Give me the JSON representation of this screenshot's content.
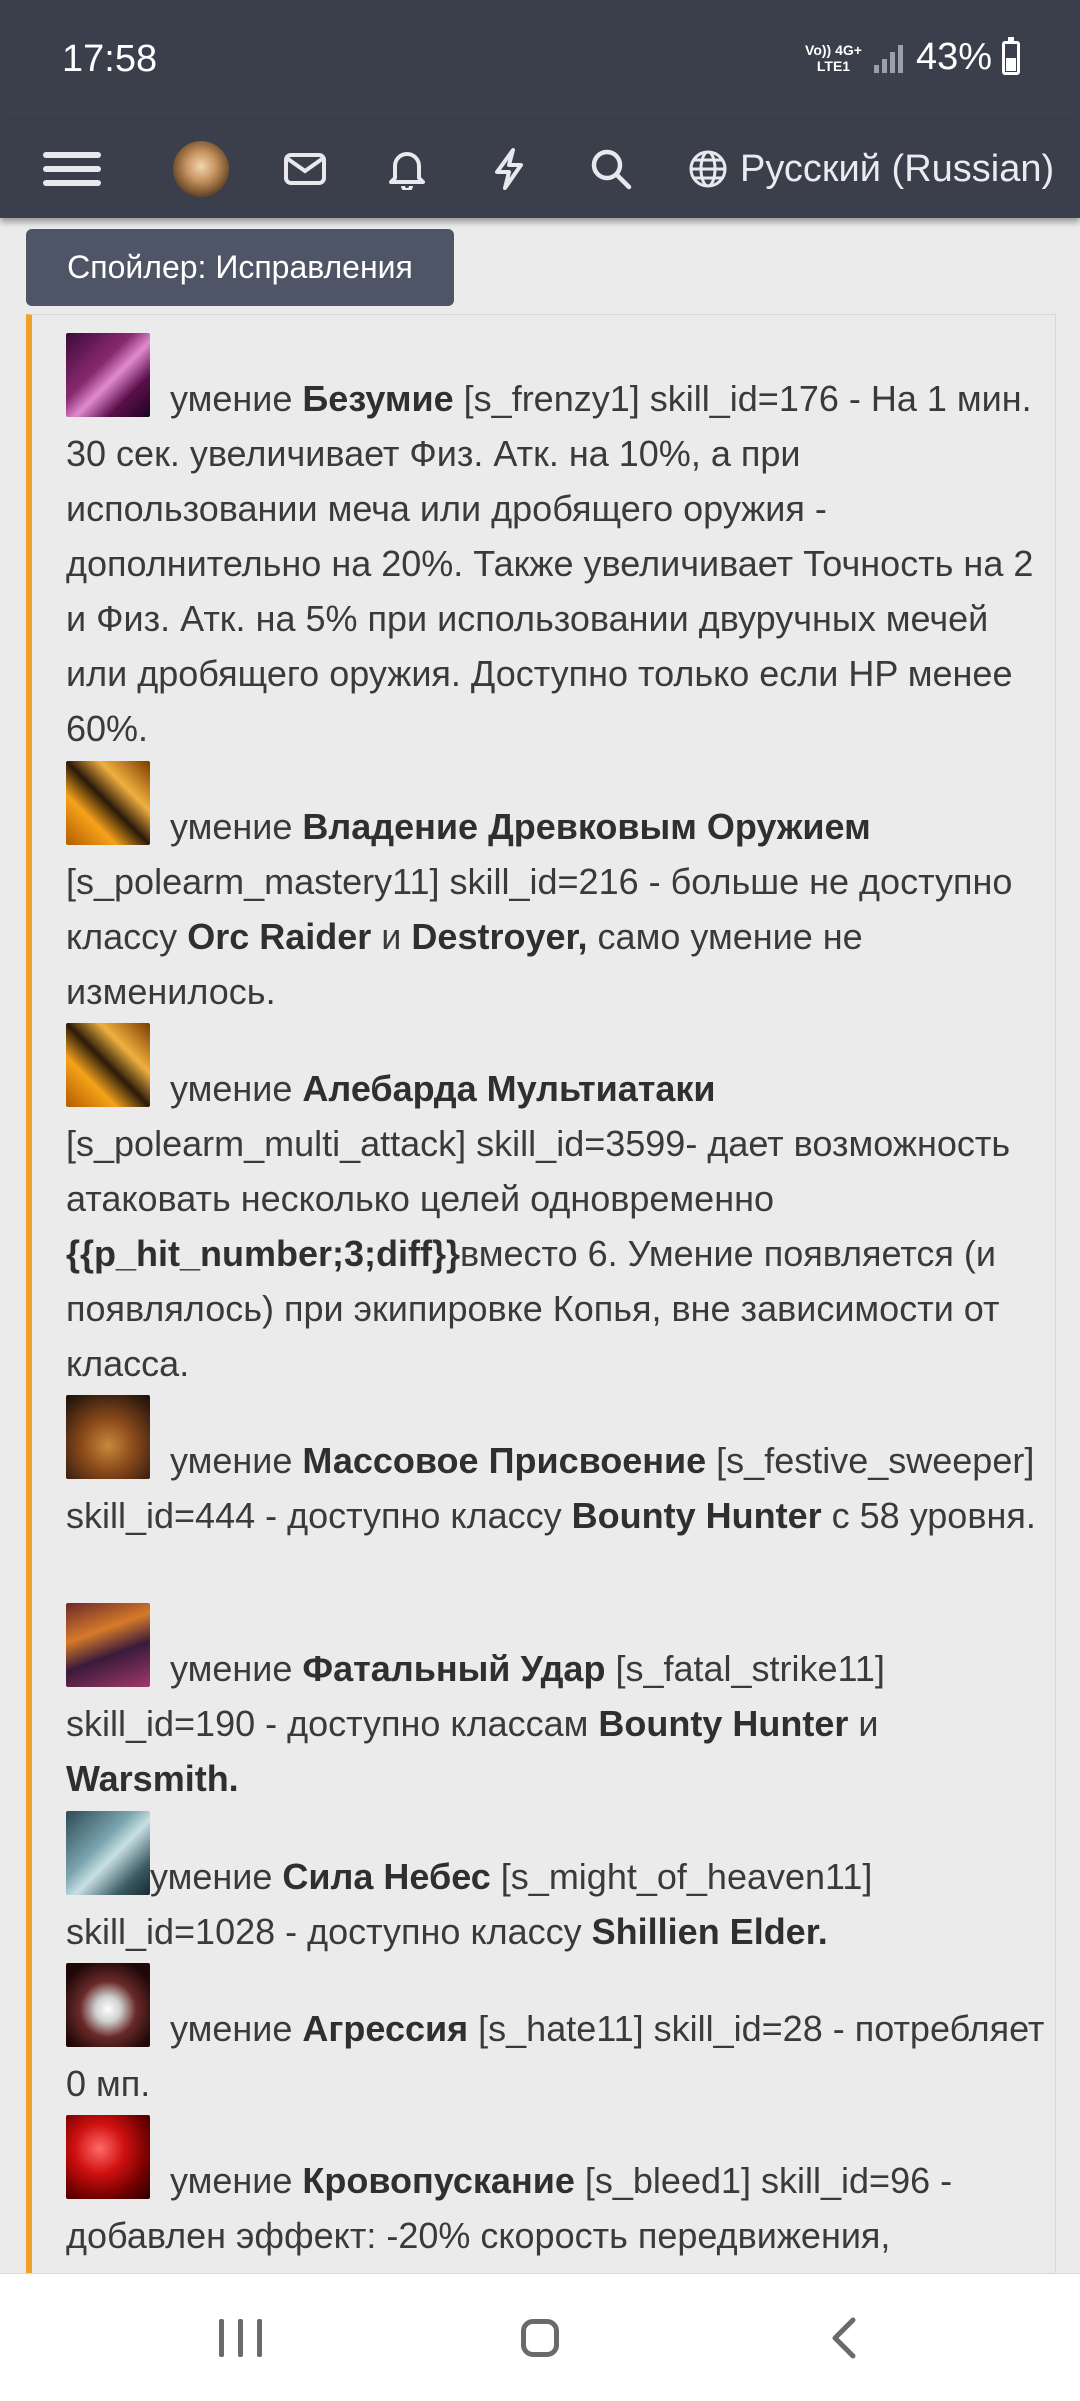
{
  "status_bar": {
    "time": "17:58",
    "network_top": "Vo)) 4G+",
    "network_bottom": "LTE1",
    "battery_percent": "43%",
    "battery_level": 0.43
  },
  "nav": {
    "language": "Русский (Russian)",
    "icons": [
      "menu-icon",
      "avatar",
      "mail-icon",
      "bell-icon",
      "lightning-icon",
      "search-icon",
      "globe-icon"
    ]
  },
  "spoiler": {
    "label": "Спойлер: Исправления"
  },
  "entries": [
    {
      "prefix": "умение",
      "name": "Безумие",
      "text1": "[s_frenzy1] skill_id=176 - На 1 мин. 30 сек. увеличивает Физ. Атк. на 10%, а при использовании меча или дробящего оружия - дополнительно на 20%. Также увеличивает Точность на 2 и Физ. Атк. на 5% при использовании двуручных мечей или дробящего оружия. Доступно только если HP менее 60%."
    },
    {
      "prefix": "умение",
      "name": "Владение Древковым Оружием",
      "text1": "[s_polearm_mastery11] skill_id=216 - больше не доступно классу",
      "bold2": "Orc Raider",
      "text2": "и",
      "bold3": "Destroyer,",
      "text3": "само умение не изменилось."
    },
    {
      "prefix": "умение",
      "name": "Алебарда Мультиатаки",
      "text1": "[s_polearm_multi_attack] skill_id=3599- дает возможность атаковать несколько целей одновременно",
      "bold2": "{{p_hit_number;3;diff}}",
      "text2": "вместо 6. Умение появляется (и появлялось) при экипировке Копья, вне зависимости от класса."
    },
    {
      "prefix": "умение",
      "name": "Массовое Присвоение",
      "text1": "[s_festive_sweeper] skill_id=444 - доступно классу",
      "bold2": "Bounty Hunter",
      "text2": "с 58 уровня."
    },
    {
      "prefix": "умение",
      "name": "Фатальный Удар",
      "text1": "[s_fatal_strike11] skill_id=190 - доступно классам",
      "bold2": "Bounty Hunter",
      "text2": "и",
      "bold3": "Warsmith."
    },
    {
      "prefix": "умение",
      "name": "Сила Небес",
      "text1": "[s_might_of_heaven11] skill_id=1028 - доступно классу",
      "bold2": "Shillien Elder."
    },
    {
      "prefix": "умение",
      "name": "Агрессия",
      "text1": "[s_hate11] skill_id=28 - потребляет 0 мп."
    },
    {
      "prefix": "умение",
      "name": "Кровопускание",
      "text1": "[s_bleed1] skill_id=96 - добавлен эффект: -20% скорость передвижения,"
    }
  ]
}
